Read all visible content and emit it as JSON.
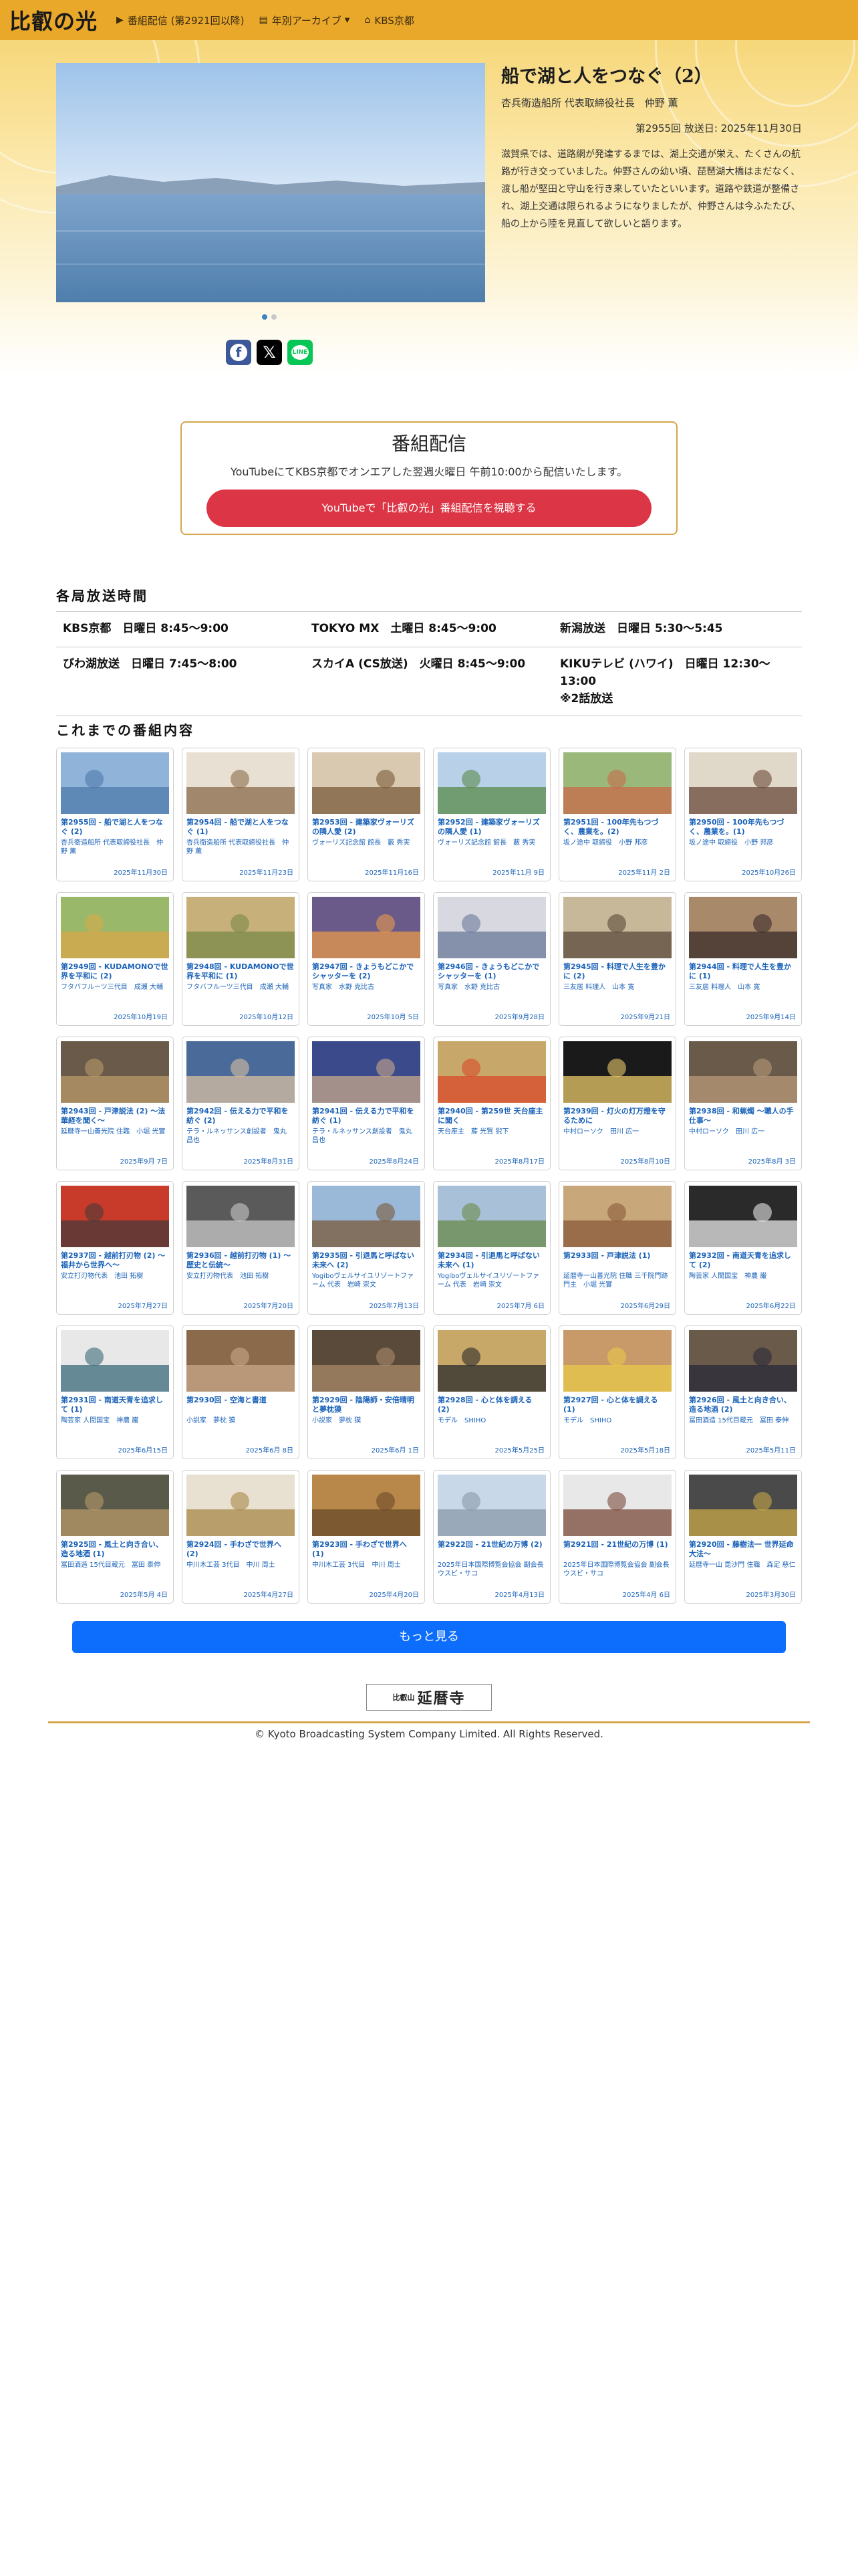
{
  "navbar": {
    "brand": "比叡の光",
    "items": [
      {
        "icon": "youtube-icon",
        "glyph": "▶",
        "label": "番組配信 (第2921回以降)"
      },
      {
        "icon": "archive-icon",
        "glyph": "▤",
        "label": "年別アーカイブ"
      },
      {
        "icon": "home-icon",
        "glyph": "⌂",
        "label": "KBS京都"
      }
    ]
  },
  "hero": {
    "title": "船で湖と人をつなぐ（2）",
    "guest": "杏兵衛造船所 代表取締役社長　仲野 薫",
    "date": "第2955回 放送日: 2025年11月30日",
    "description": "滋賀県では、道路網が発達するまでは、湖上交通が栄え、たくさんの航路が行き交っていました。仲野さんの幼い頃、琵琶湖大橋はまだなく、渡し船が堅田と守山を行き来していたといいます。道路や鉄道が整備され、湖上交通は限られるようになりましたが、仲野さんは今ふたたび、船の上から陸を見直して欲しいと語ります。"
  },
  "share": {
    "facebook": "f",
    "x": "𝕏",
    "line": "LINE"
  },
  "stream": {
    "title": "番組配信",
    "text": "YouTubeにてKBS京都でオンエアした翌週火曜日 午前10:00から配信いたします。",
    "button": "YouTubeで「比叡の光」番組配信を視聴する"
  },
  "schedule": {
    "title": "各局放送時間",
    "rows": [
      [
        "KBS京都　日曜日 8:45〜9:00",
        "TOKYO MX　土曜日 8:45〜9:00",
        "新潟放送　日曜日 5:30〜5:45"
      ],
      [
        "びわ湖放送　日曜日 7:45〜8:00",
        "スカイA (CS放送)　火曜日 8:45〜9:00",
        "KIKUテレビ (ハワイ)　日曜日 12:30〜13:00\n※2話放送"
      ]
    ]
  },
  "episodes_title": "これまでの番組内容",
  "episodes": [
    {
      "title": "第2955回 - 船で湖と人をつなぐ (2)",
      "guest": "杏兵衛造船所 代表取締役社長　仲野 薫",
      "date": "2025年11月30日",
      "c1": "#8fb3d9",
      "c2": "#4d7aa8"
    },
    {
      "title": "第2954回 - 船で湖と人をつなぐ (1)",
      "guest": "杏兵衛造船所 代表取締役社長　仲野 薫",
      "date": "2025年11月23日",
      "c1": "#e8e0d2",
      "c2": "#8a6a4a"
    },
    {
      "title": "第2953回 - 建築家ヴォーリズの隣人愛 (2)",
      "guest": "ヴォーリズ記念館 館長　藪 秀実",
      "date": "2025年11月16日",
      "c1": "#d8c9b0",
      "c2": "#7a5a3a"
    },
    {
      "title": "第2952回 - 建築家ヴォーリズの隣人愛 (1)",
      "guest": "ヴォーリズ記念館 館長　藪 秀実",
      "date": "2025年11月 9日",
      "c1": "#b8d0e8",
      "c2": "#5a8a4a"
    },
    {
      "title": "第2951回 - 100年先もつづく、農業を。(2)",
      "guest": "坂ノ途中 取締役　小野 邦彦",
      "date": "2025年11月 2日",
      "c1": "#9ab87a",
      "c2": "#c86a4a"
    },
    {
      "title": "第2950回 - 100年先もつづく、農業を。(1)",
      "guest": "坂ノ途中 取締役　小野 邦彦",
      "date": "2025年10月26日",
      "c1": "#e0d8c8",
      "c2": "#6a4a3a"
    },
    {
      "title": "第2949回 - KUDAMONOで世界を平和に (2)",
      "guest": "フタバフルーツ三代目　成瀬 大輔",
      "date": "2025年10月19日",
      "c1": "#9ab86a",
      "c2": "#d8a84a"
    },
    {
      "title": "第2948回 - KUDAMONOで世界を平和に (1)",
      "guest": "フタバフルーツ三代目　成瀬 大輔",
      "date": "2025年10月12日",
      "c1": "#c8b07a",
      "c2": "#7a8a4a"
    },
    {
      "title": "第2947回 - きょうもどこかでシャッターを (2)",
      "guest": "写真家　水野 克比古",
      "date": "2025年10月 5日",
      "c1": "#6a5a8a",
      "c2": "#e89a4a"
    },
    {
      "title": "第2946回 - きょうもどこかでシャッターを (1)",
      "guest": "写真家　水野 克比古",
      "date": "2025年9月28日",
      "c1": "#d8d8e0",
      "c2": "#6a7a9a"
    },
    {
      "title": "第2945回 - 料理で人生を豊かに (2)",
      "guest": "三友居 料理人　山本 寛",
      "date": "2025年9月21日",
      "c1": "#c8b89a",
      "c2": "#5a4a3a"
    },
    {
      "title": "第2944回 - 料理で人生を豊かに (1)",
      "guest": "三友居 料理人　山本 寛",
      "date": "2025年9月14日",
      "c1": "#a88a6a",
      "c2": "#3a2a2a"
    },
    {
      "title": "第2943回 - 戸津説法 (2) 〜法華経を聞く〜",
      "guest": "延暦寺一山善光院 住職　小堀 光實",
      "date": "2025年9月 7日",
      "c1": "#6a5a4a",
      "c2": "#b89a6a"
    },
    {
      "title": "第2942回 - 伝える力で平和を紡ぐ (2)",
      "guest": "テラ・ルネッサンス創設者　鬼丸 昌也",
      "date": "2025年8月31日",
      "c1": "#4a6a9a",
      "c2": "#d8c0a0"
    },
    {
      "title": "第2941回 - 伝える力で平和を紡ぐ (1)",
      "guest": "テラ・ルネッサンス創設者　鬼丸 昌也",
      "date": "2025年8月24日",
      "c1": "#3a4a8a",
      "c2": "#c8a88a"
    },
    {
      "title": "第2940回 - 第259世 天台座主に聞く",
      "guest": "天台座主　藤 光賢 猊下",
      "date": "2025年8月17日",
      "c1": "#c8a86a",
      "c2": "#d84a2a"
    },
    {
      "title": "第2939回 - 灯火の灯万燈を守るために",
      "guest": "中村ローソク　田川 広一",
      "date": "2025年8月10日",
      "c1": "#1a1a1a",
      "c2": "#e8c86a"
    },
    {
      "title": "第2938回 - 和蝋燭 〜職人の手仕事〜",
      "guest": "中村ローソク　田川 広一",
      "date": "2025年8月 3日",
      "c1": "#6a5a4a",
      "c2": "#b89a7a"
    },
    {
      "title": "第2937回 - 越前打刃物 (2) 〜福井から世界へ〜",
      "guest": "安立打刃物代表　池田 拓樹",
      "date": "2025年7月27日",
      "c1": "#c83a2a",
      "c2": "#4a3a3a"
    },
    {
      "title": "第2936回 - 越前打刃物 (1) 〜歴史と伝統〜",
      "guest": "安立打刃物代表　池田 拓樹",
      "date": "2025年7月20日",
      "c1": "#5a5a5a",
      "c2": "#c8c8c8"
    },
    {
      "title": "第2935回 - 引退馬と呼ばない未来へ (2)",
      "guest": "Yogiboヴェルサイユリゾートファーム 代表　岩崎 崇文",
      "date": "2025年7月13日",
      "c1": "#9ab8d8",
      "c2": "#7a5a3a"
    },
    {
      "title": "第2934回 - 引退馬と呼ばない未来へ (1)",
      "guest": "Yogiboヴェルサイユリゾートファーム 代表　岩崎 崇文",
      "date": "2025年7月 6日",
      "c1": "#a8c0d8",
      "c2": "#6a8a4a"
    },
    {
      "title": "第2933回 - 戸津説法 (1)",
      "guest": "延暦寺一山善光院 住職 三千院門跡門主　小堀 光實",
      "date": "2025年6月29日",
      "c1": "#c8a87a",
      "c2": "#8a5a3a"
    },
    {
      "title": "第2932回 - 南道天青を追求して (2)",
      "guest": "陶芸家 人間国宝　神農 巌",
      "date": "2025年6月22日",
      "c1": "#2a2a2a",
      "c2": "#e8e8e8"
    },
    {
      "title": "第2931回 - 南道天青を追求して (1)",
      "guest": "陶芸家 人間国宝　神農 巌",
      "date": "2025年6月15日",
      "c1": "#e8e8e8",
      "c2": "#3a6a7a"
    },
    {
      "title": "第2930回 - 空海と書道",
      "guest": "小説家　夢枕 獏",
      "date": "2025年6月 8日",
      "c1": "#8a6a4a",
      "c2": "#c8a88a"
    },
    {
      "title": "第2929回 - 陰陽師・安倍晴明と夢枕獏",
      "guest": "小説家　夢枕 獏",
      "date": "2025年6月 1日",
      "c1": "#5a4a3a",
      "c2": "#a88a6a"
    },
    {
      "title": "第2928回 - 心と体を調える (2)",
      "guest": "モデル　SHIHO",
      "date": "2025年5月25日",
      "c1": "#c8a868",
      "c2": "#2a2a2a"
    },
    {
      "title": "第2927回 - 心と体を調える (1)",
      "guest": "モデル　SHIHO",
      "date": "2025年5月18日",
      "c1": "#c89a6a",
      "c2": "#e8c84a"
    },
    {
      "title": "第2926回 - 風土と向き合い、造る地酒 (2)",
      "guest": "冨田酒造 15代目蔵元　冨田 泰伸",
      "date": "2025年5月11日",
      "c1": "#6a5a4a",
      "c2": "#2a2a3a"
    },
    {
      "title": "第2925回 - 風土と向き合い、造る地酒 (1)",
      "guest": "冨田酒造 15代目蔵元　冨田 泰伸",
      "date": "2025年5月 4日",
      "c1": "#5a5a4a",
      "c2": "#b89a6a"
    },
    {
      "title": "第2924回 - 手わざで世界へ (2)",
      "guest": "中川木工芸 3代目　中川 周士",
      "date": "2025年4月27日",
      "c1": "#e8e0d0",
      "c2": "#a8884a"
    },
    {
      "title": "第2923回 - 手わざで世界へ (1)",
      "guest": "中川木工芸 3代目　中川 周士",
      "date": "2025年4月20日",
      "c1": "#b8884a",
      "c2": "#6a4a2a"
    },
    {
      "title": "第2922回 - 21世紀の万博 (2)",
      "guest": "2025年日本国際博覧会協会 副会長　ウスビ・サコ",
      "date": "2025年4月13日",
      "c1": "#c8d8e8",
      "c2": "#8a9aaa"
    },
    {
      "title": "第2921回 - 21世紀の万博 (1)",
      "guest": "2025年日本国際博覧会協会 副会長　ウスビ・サコ",
      "date": "2025年4月 6日",
      "c1": "#e8e8e8",
      "c2": "#7a4a3a"
    },
    {
      "title": "第2920回 - 藤樹法一 世界延命大法〜",
      "guest": "延暦寺一山 毘沙門 住職　森定 慈仁",
      "date": "2025年3月30日",
      "c1": "#4a4a4a",
      "c2": "#c8a84a"
    }
  ],
  "more_button": "もっと見る",
  "sponsor": {
    "small": "比叡山",
    "big": "延暦寺"
  },
  "footer": "© Kyoto Broadcasting System Company Limited. All Rights Reserved."
}
